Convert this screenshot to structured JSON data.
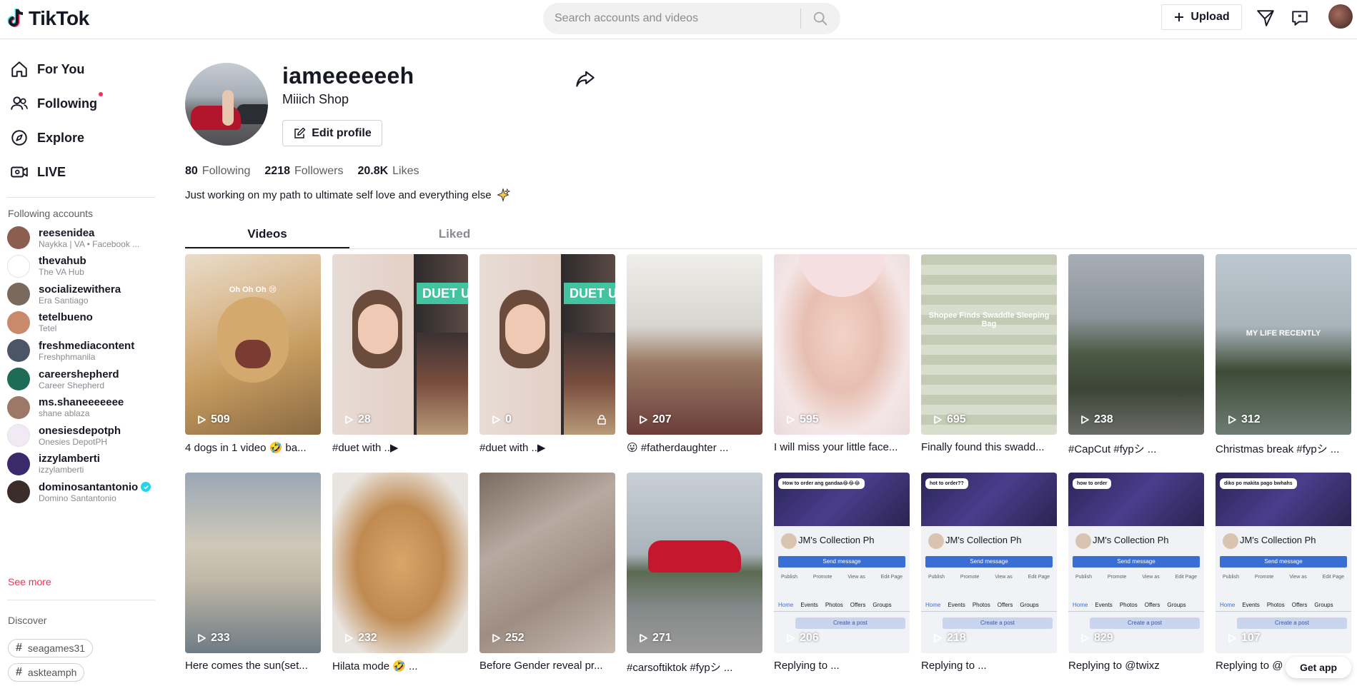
{
  "header": {
    "logo_text": "TikTok",
    "search_placeholder": "Search accounts and videos",
    "upload_label": "Upload"
  },
  "nav": [
    {
      "label": "For You",
      "icon": "home-icon"
    },
    {
      "label": "Following",
      "icon": "people-icon"
    },
    {
      "label": "Explore",
      "icon": "compass-icon"
    },
    {
      "label": "LIVE",
      "icon": "live-icon"
    }
  ],
  "following_title": "Following accounts",
  "accounts": [
    {
      "name": "reesenidea",
      "sub": "Naykka | VA • Facebook ...",
      "color": "#8b5e4f"
    },
    {
      "name": "thevahub",
      "sub": "The VA Hub",
      "color": "#ffffff"
    },
    {
      "name": "socializewithera",
      "sub": "Era Santiago",
      "color": "#7a6a5e"
    },
    {
      "name": "tetelbueno",
      "sub": "Tetel",
      "color": "#c98a6b"
    },
    {
      "name": "freshmediacontent",
      "sub": "Freshphmanila",
      "color": "#4a5566"
    },
    {
      "name": "careershepherd",
      "sub": "Career Shepherd",
      "color": "#1e6b56"
    },
    {
      "name": "ms.shaneeeeeee",
      "sub": "shane ablaza",
      "color": "#9c7868"
    },
    {
      "name": "onesiesdepotph",
      "sub": "Onesies DepotPH",
      "color": "#f1e9f3"
    },
    {
      "name": "izzylamberti",
      "sub": "izzylamberti",
      "color": "#3a2a6a"
    },
    {
      "name": "dominosantantonio",
      "sub": "Domino Santantonio",
      "color": "#3b2e2a",
      "verified": true
    }
  ],
  "see_more": "See more",
  "discover_title": "Discover",
  "discover_tags": [
    "seagames31",
    "askteamph"
  ],
  "profile": {
    "username": "iameeeeeeh",
    "display_name": "Miiich Shop",
    "edit_label": "Edit profile",
    "following_count": "80",
    "following_label": "Following",
    "followers_count": "2218",
    "followers_label": "Followers",
    "likes_count": "20.8K",
    "likes_label": "Likes",
    "bio": "Just working on my path to ultimate self love and everything else"
  },
  "tabs": {
    "videos": "Videos",
    "liked": "Liked"
  },
  "videos": [
    {
      "views": "509",
      "caption": "4 dogs in 1 video 🤣 ba...",
      "overlay": "Oh Oh Oh 😢",
      "style": "dog"
    },
    {
      "views": "28",
      "caption": "#duet with ..▶",
      "style": "duet",
      "banner": "DUET U"
    },
    {
      "views": "0",
      "caption": "#duet with ..▶",
      "style": "duet",
      "banner": "DUET U",
      "private": true
    },
    {
      "views": "207",
      "caption": "😛 #fatherdaughter ...",
      "style": "father"
    },
    {
      "views": "595",
      "caption": "I will miss your little face...",
      "style": "baby"
    },
    {
      "views": "695",
      "caption": "Finally found this swadd...",
      "style": "swaddle",
      "overlay": "Shopee Finds Swaddle Sleeping Bag"
    },
    {
      "views": "238",
      "caption": "#CapCut #fypシ ...",
      "style": "mountain"
    },
    {
      "views": "312",
      "caption": "Christmas break #fypシ ...",
      "style": "palms",
      "overlay": "MY LIFE RECENTLY"
    },
    {
      "views": "233",
      "caption": "Here comes the sun(set...",
      "style": "sunset"
    },
    {
      "views": "232",
      "caption": "Hilata mode 🤣 ...",
      "style": "teddy"
    },
    {
      "views": "252",
      "caption": "Before Gender reveal pr...",
      "style": "floor"
    },
    {
      "views": "271",
      "caption": "#carsoftiktok #fypシ ...",
      "style": "car"
    },
    {
      "views": "206",
      "caption": "Replying to ...",
      "style": "fb",
      "bubble": "How to order ang gandaa😂😂😂"
    },
    {
      "views": "218",
      "caption": "Replying to ...",
      "style": "fb",
      "bubble": "hot to order??"
    },
    {
      "views": "829",
      "caption": "Replying to @twixz",
      "style": "fb",
      "bubble": "how to order"
    },
    {
      "views": "107",
      "caption": "Replying to @",
      "style": "fb",
      "bubble": "diko po makita pago bwhahs"
    }
  ],
  "fb_mock": {
    "page_name": "JM's Collection Ph",
    "send_message": "Send message",
    "tabs": [
      "Home",
      "Events",
      "Photos",
      "Offers",
      "Groups"
    ],
    "actions": [
      "Publish",
      "Promote",
      "View as",
      "Edit Page"
    ],
    "create_post": "Create a post"
  },
  "get_app": "Get app",
  "colors": {
    "accent": "#fe2c55",
    "verified": "#20d5ec"
  }
}
